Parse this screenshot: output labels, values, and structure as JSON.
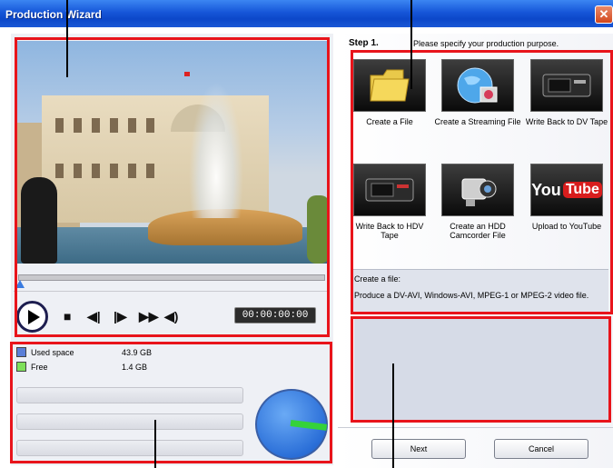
{
  "window": {
    "title": "Production Wizard",
    "close_symbol": "✕"
  },
  "player": {
    "timecode": "00:00:00:00",
    "seek_position": 0
  },
  "disk": {
    "legend": [
      {
        "label": "Used space",
        "value": "43.9 GB",
        "color": "#5b7fd8"
      },
      {
        "label": "Free",
        "value": "1.4 GB",
        "color": "#7fe05a"
      }
    ],
    "used_fraction": 0.97
  },
  "step": {
    "label": "Step 1.",
    "instruction": "Please specify your production purpose."
  },
  "options": [
    {
      "label": "Create a File",
      "icon": "folder-icon"
    },
    {
      "label": "Create a Streaming File",
      "icon": "globe-icon"
    },
    {
      "label": "Write Back to DV Tape",
      "icon": "dv-tape-icon"
    },
    {
      "label": "Write Back to HDV Tape",
      "icon": "hdv-tape-icon"
    },
    {
      "label": "Create an HDD Camcorder File",
      "icon": "camcorder-icon"
    },
    {
      "label": "Upload to YouTube",
      "icon": "youtube-icon"
    }
  ],
  "youtube_logo": {
    "you": "You",
    "tube": "Tube"
  },
  "description": {
    "heading": "Create a file:",
    "body": "Produce a DV-AVI, Windows-AVI, MPEG-1 or MPEG-2 video file."
  },
  "buttons": {
    "next": "Next",
    "cancel": "Cancel"
  },
  "annotation_color": "#e8141b"
}
